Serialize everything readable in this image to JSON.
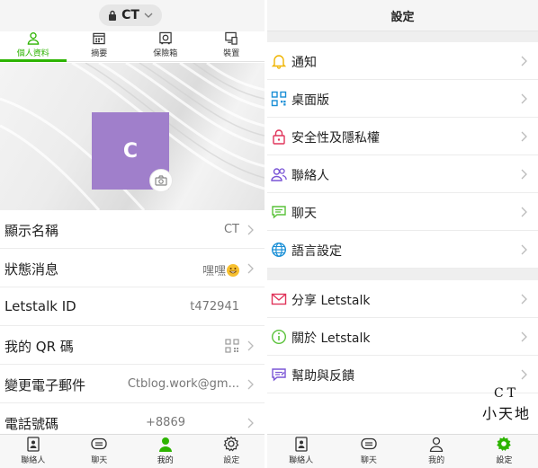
{
  "profile_screen": {
    "account_name": "CT",
    "tabs": [
      {
        "label": "個人資料",
        "icon": "person-icon",
        "active": true
      },
      {
        "label": "摘要",
        "icon": "calendar-icon",
        "active": false
      },
      {
        "label": "保險箱",
        "icon": "safe-icon",
        "active": false
      },
      {
        "label": "裝置",
        "icon": "devices-icon",
        "active": false
      }
    ],
    "avatar_initial": "C",
    "avatar_color": "#a07fcb",
    "rows": [
      {
        "label": "顯示名稱",
        "value": "CT"
      },
      {
        "label": "狀態消息",
        "value": "嘿嘿"
      },
      {
        "label": "Letstalk ID",
        "value": "t472941"
      },
      {
        "label": "我的 QR 碼",
        "value": ""
      },
      {
        "label": "變更電子郵件",
        "value": "Ctblog.work@gm..."
      },
      {
        "label": "電話號碼",
        "value": "+8869"
      }
    ]
  },
  "settings_screen": {
    "title": "設定",
    "group1": [
      {
        "label": "通知",
        "icon": "bell-icon",
        "color": "#f0b400"
      },
      {
        "label": "桌面版",
        "icon": "qr-desktop-icon",
        "color": "#1a8fd6"
      },
      {
        "label": "安全性及隱私權",
        "icon": "lock-icon",
        "color": "#e0345a"
      },
      {
        "label": "聯絡人",
        "icon": "contacts-icon",
        "color": "#7a55d6"
      },
      {
        "label": "聊天",
        "icon": "chat-icon",
        "color": "#5ac23a"
      },
      {
        "label": "語言設定",
        "icon": "globe-icon",
        "color": "#1a8fd6"
      }
    ],
    "group2": [
      {
        "label": "分享 Letstalk",
        "icon": "mail-icon",
        "color": "#e0345a"
      },
      {
        "label": "關於 Letstalk",
        "icon": "info-icon",
        "color": "#5ac23a"
      },
      {
        "label": "幫助與反饋",
        "icon": "feedback-icon",
        "color": "#7a55d6"
      }
    ]
  },
  "bottom_nav": [
    {
      "label": "聯絡人",
      "icon": "contacts-book-icon"
    },
    {
      "label": "聊天",
      "icon": "chat-bubble-icon"
    },
    {
      "label": "我的",
      "icon": "me-icon"
    },
    {
      "label": "設定",
      "icon": "gear-icon"
    }
  ],
  "accent_color": "#2db400",
  "watermark": {
    "line1": "CT",
    "line2": "小天地"
  }
}
